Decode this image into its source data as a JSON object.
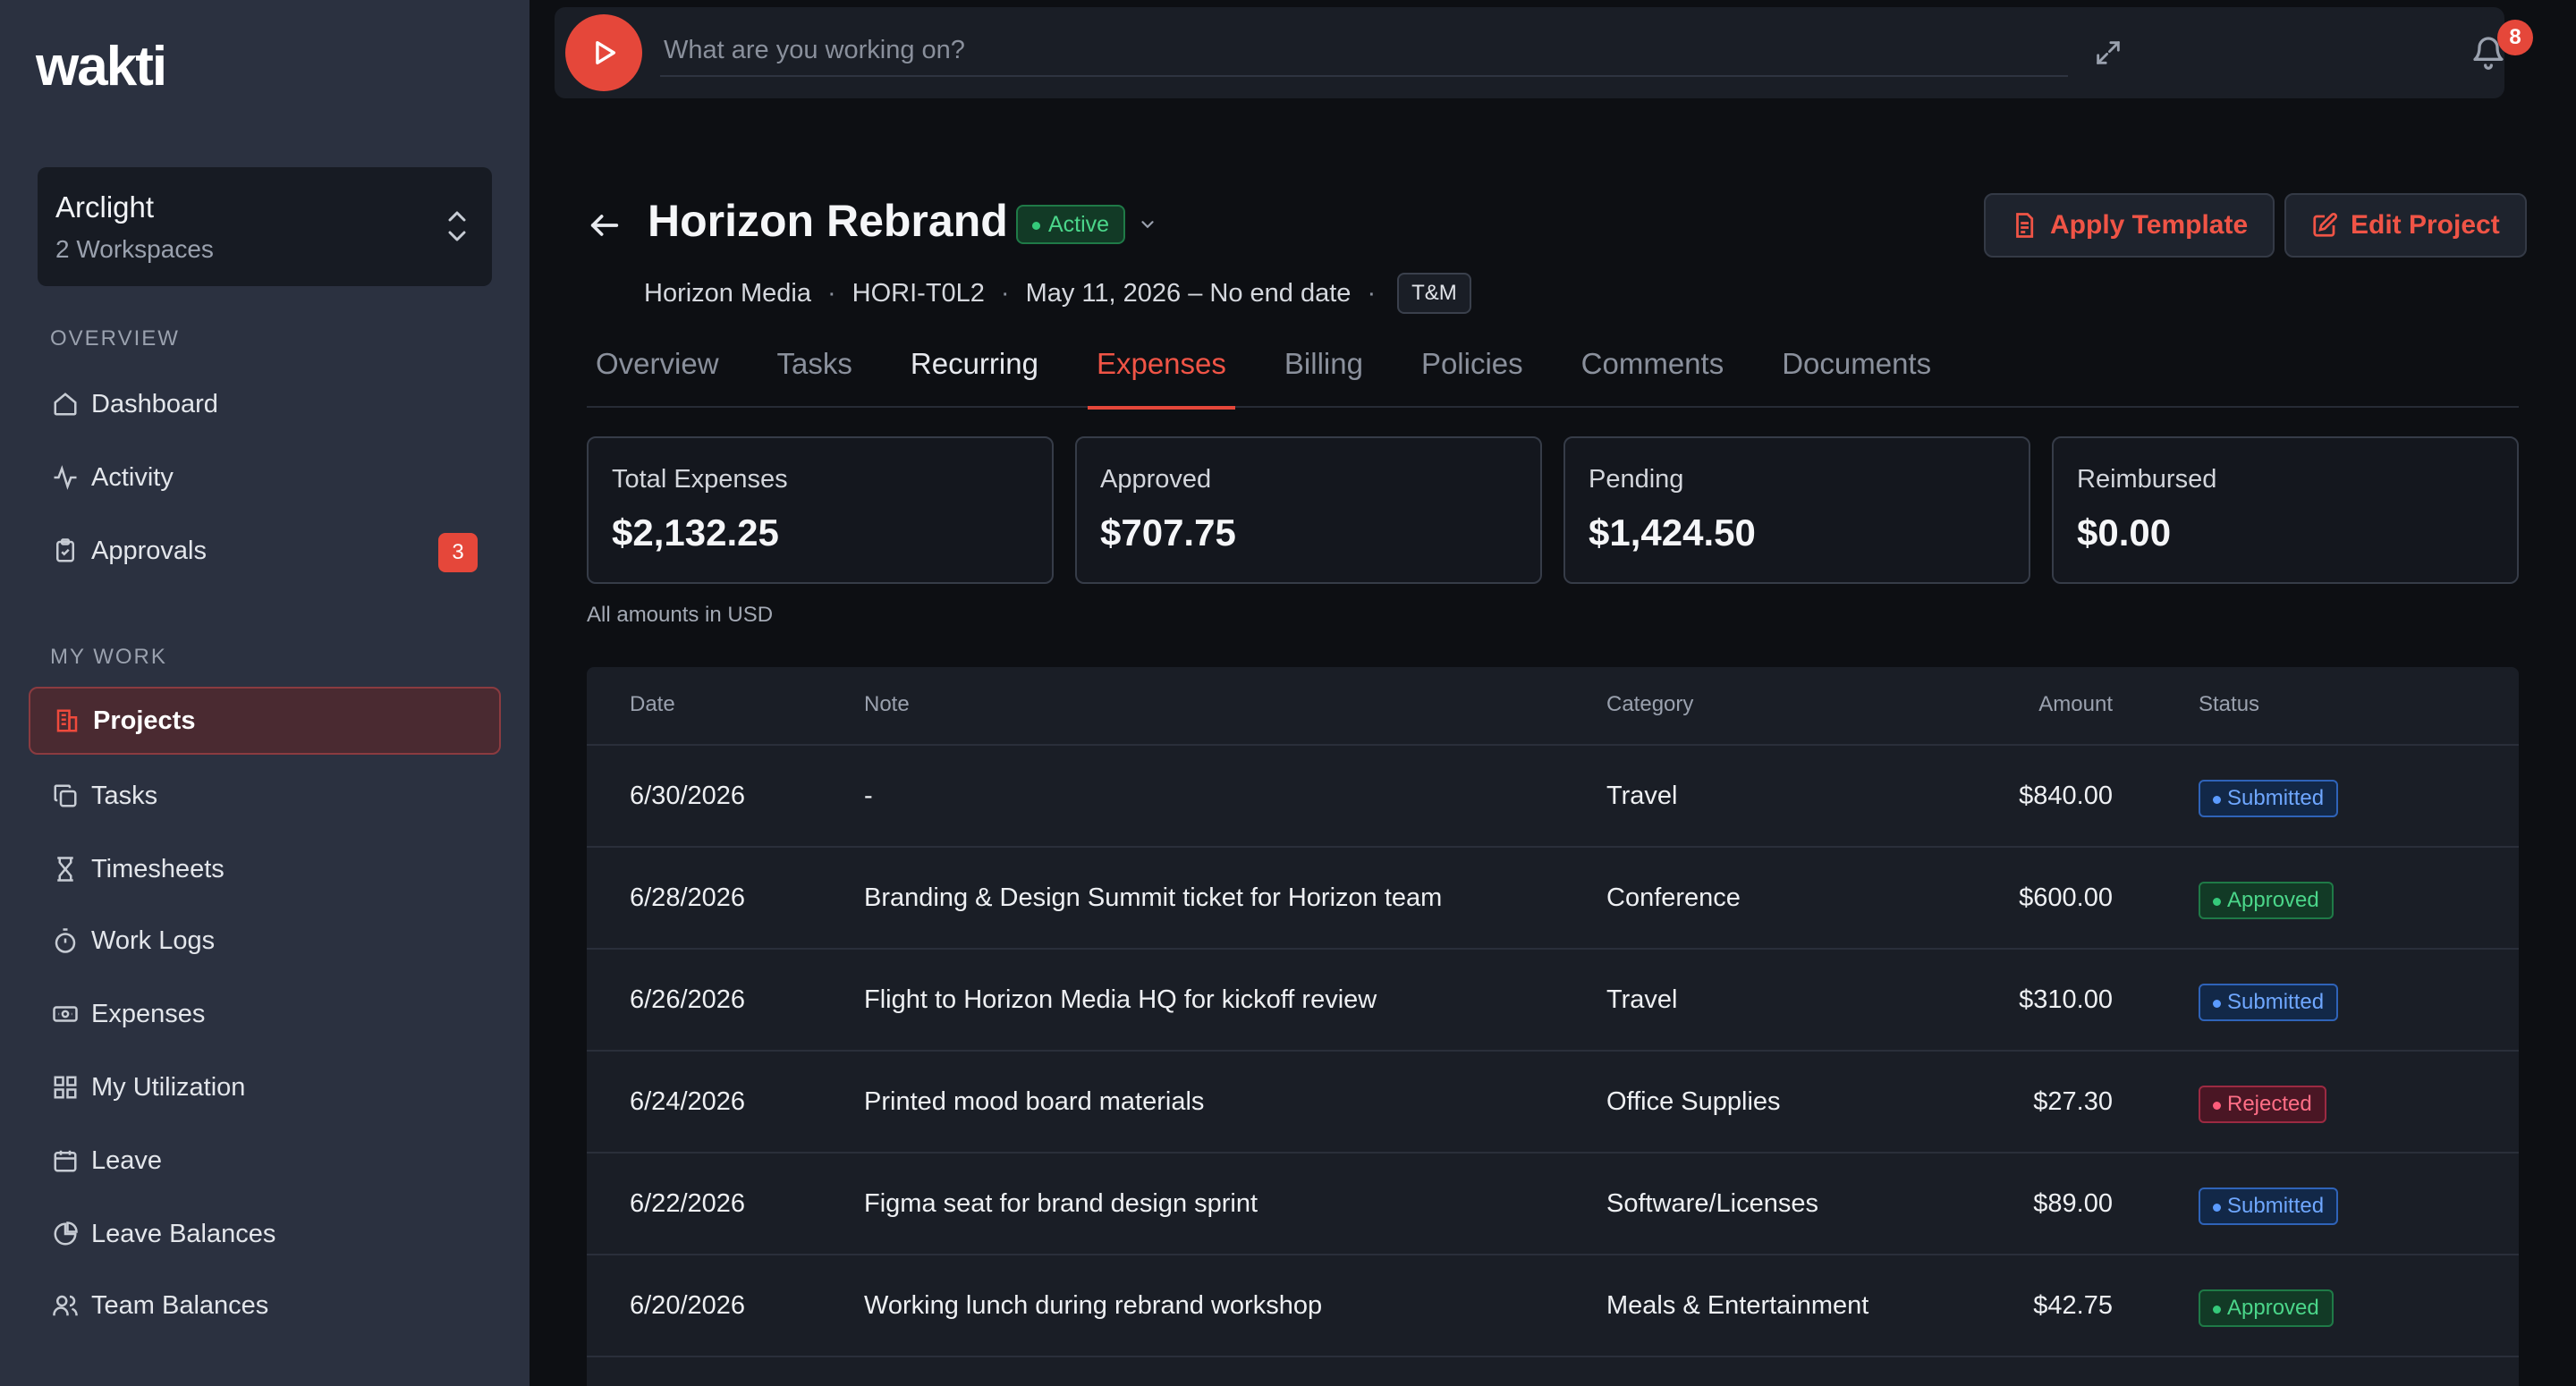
{
  "app": {
    "logo_text": "wakti"
  },
  "workspace": {
    "name": "Arclight",
    "subtitle": "2 Workspaces"
  },
  "sidebar": {
    "overview_label": "OVERVIEW",
    "my_work_label": "MY WORK",
    "overview_items": [
      {
        "label": "Dashboard",
        "icon": "home-icon"
      },
      {
        "label": "Activity",
        "icon": "activity-icon"
      },
      {
        "label": "Approvals",
        "icon": "clipboard-check-icon",
        "badge": "3"
      }
    ],
    "work_items": [
      {
        "label": "Projects",
        "icon": "building-icon",
        "active": true
      },
      {
        "label": "Tasks",
        "icon": "copy-icon"
      },
      {
        "label": "Timesheets",
        "icon": "hourglass-icon"
      },
      {
        "label": "Work Logs",
        "icon": "stopwatch-icon"
      },
      {
        "label": "Expenses",
        "icon": "banknote-icon"
      },
      {
        "label": "My Utilization",
        "icon": "grid-icon"
      },
      {
        "label": "Leave",
        "icon": "calendar-icon"
      },
      {
        "label": "Leave Balances",
        "icon": "pie-chart-icon"
      },
      {
        "label": "Team Balances",
        "icon": "users-icon"
      }
    ]
  },
  "timer": {
    "placeholder": "What are you working on?",
    "notifications_count": "8"
  },
  "project": {
    "title": "Horizon Rebrand",
    "status": "Active",
    "client": "Horizon Media",
    "code": "HORI-T0L2",
    "dates": "May 11, 2026 – No end date",
    "billing_type": "T&M",
    "apply_template_label": "Apply Template",
    "edit_project_label": "Edit Project"
  },
  "tabs": [
    "Overview",
    "Tasks",
    "Recurring",
    "Expenses",
    "Billing",
    "Policies",
    "Comments",
    "Documents"
  ],
  "active_tab": "Expenses",
  "summary": {
    "cards": [
      {
        "label": "Total Expenses",
        "value": "$2,132.25"
      },
      {
        "label": "Approved",
        "value": "$707.75"
      },
      {
        "label": "Pending",
        "value": "$1,424.50"
      },
      {
        "label": "Reimbursed",
        "value": "$0.00"
      }
    ],
    "currency_note": "All amounts in USD"
  },
  "table": {
    "headers": {
      "date": "Date",
      "note": "Note",
      "category": "Category",
      "amount": "Amount",
      "status": "Status"
    },
    "rows": [
      {
        "date": "6/30/2026",
        "note": "-",
        "category": "Travel",
        "amount": "$840.00",
        "status": "Submitted"
      },
      {
        "date": "6/28/2026",
        "note": "Branding & Design Summit ticket for Horizon team",
        "category": "Conference",
        "amount": "$600.00",
        "status": "Approved"
      },
      {
        "date": "6/26/2026",
        "note": "Flight to Horizon Media HQ for kickoff review",
        "category": "Travel",
        "amount": "$310.00",
        "status": "Submitted"
      },
      {
        "date": "6/24/2026",
        "note": "Printed mood board materials",
        "category": "Office Supplies",
        "amount": "$27.30",
        "status": "Rejected"
      },
      {
        "date": "6/22/2026",
        "note": "Figma seat for brand design sprint",
        "category": "Software/Licenses",
        "amount": "$89.00",
        "status": "Submitted"
      },
      {
        "date": "6/20/2026",
        "note": "Working lunch during rebrand workshop",
        "category": "Meals & Entertainment",
        "amount": "$42.75",
        "status": "Approved"
      }
    ]
  },
  "colors": {
    "accent": "#e5473a",
    "sidebar_bg": "#2b3140",
    "page_bg": "#0d0f13"
  }
}
